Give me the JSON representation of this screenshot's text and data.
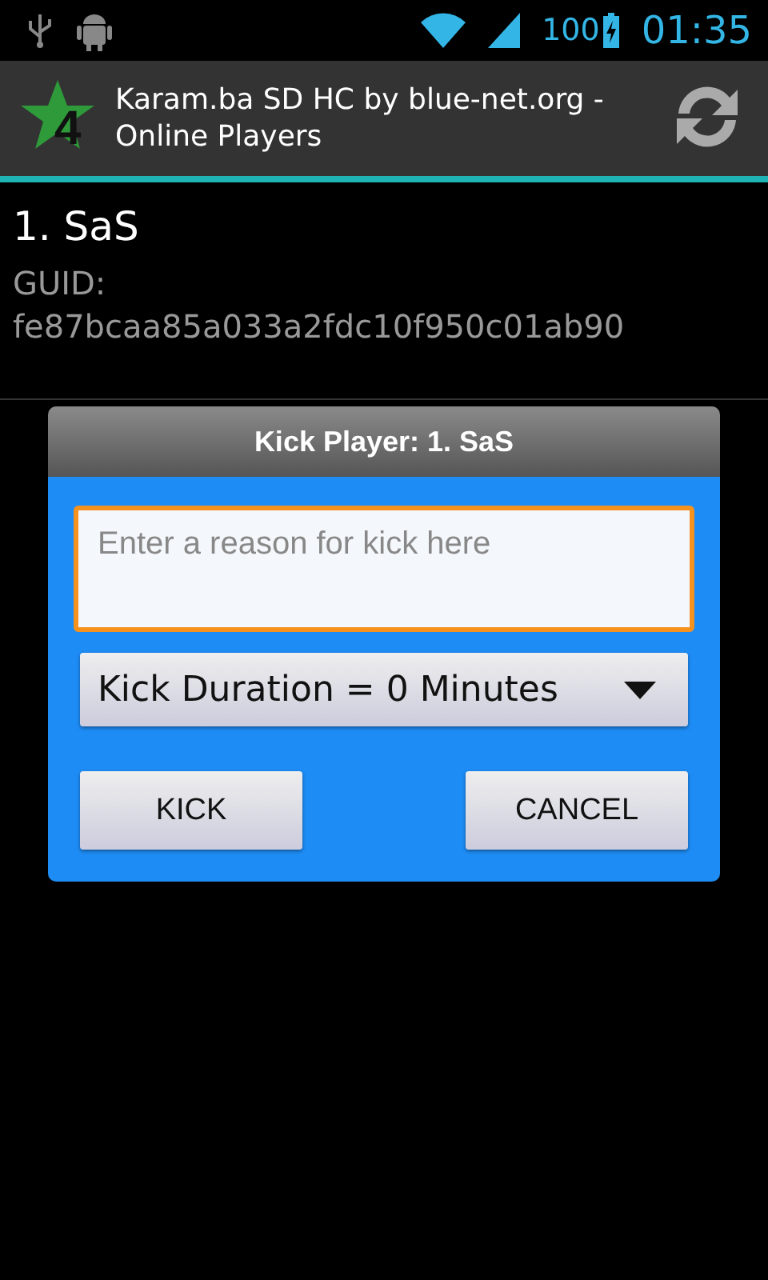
{
  "status_bar": {
    "battery": "100",
    "time": "01:35"
  },
  "action_bar": {
    "logo_number": "4",
    "title": "Karam.ba SD HC by blue-net.org - Online Players"
  },
  "player": {
    "name": "1. SaS",
    "guid_label": "GUID:",
    "guid": "fe87bcaa85a033a2fdc10f950c01ab90"
  },
  "dialog": {
    "title": "Kick Player: 1. SaS",
    "reason": {
      "placeholder": "Enter a reason for kick here",
      "focused": true
    },
    "duration": "Kick Duration = 0 Minutes",
    "buttons": [
      "KICK",
      "CANCEL"
    ]
  }
}
